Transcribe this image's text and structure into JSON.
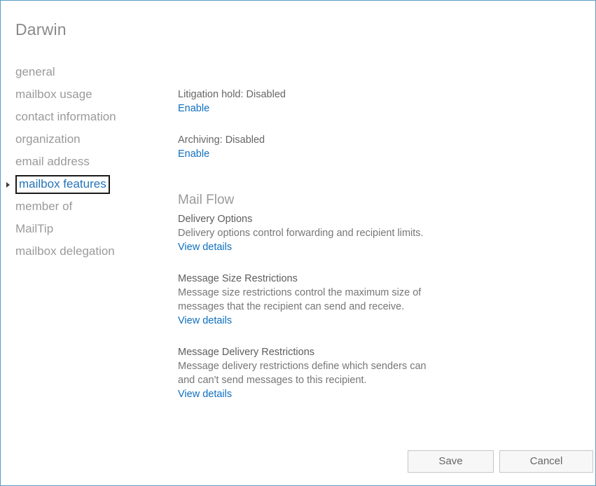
{
  "dialog": {
    "title": "Darwin"
  },
  "nav": {
    "items": [
      {
        "label": "general",
        "selected": false
      },
      {
        "label": "mailbox usage",
        "selected": false
      },
      {
        "label": "contact information",
        "selected": false
      },
      {
        "label": "organization",
        "selected": false
      },
      {
        "label": "email address",
        "selected": false
      },
      {
        "label": "mailbox features",
        "selected": true
      },
      {
        "label": "member of",
        "selected": false
      },
      {
        "label": "MailTip",
        "selected": false
      },
      {
        "label": "mailbox delegation",
        "selected": false
      }
    ]
  },
  "content": {
    "litigation_hold": {
      "status": "Litigation hold: Disabled",
      "action": "Enable"
    },
    "archiving": {
      "status": "Archiving: Disabled",
      "action": "Enable"
    },
    "mail_flow": {
      "heading": "Mail Flow",
      "groups": [
        {
          "title": "Delivery Options",
          "description": "Delivery options control forwarding and recipient limits.",
          "action": "View details"
        },
        {
          "title": "Message Size Restrictions",
          "description": "Message size restrictions control the maximum size of messages that the recipient can send and receive.",
          "action": "View details"
        },
        {
          "title": "Message Delivery Restrictions",
          "description": "Message delivery restrictions define which senders can and can't send messages to this recipient.",
          "action": "View details"
        }
      ]
    }
  },
  "footer": {
    "save_label": "Save",
    "cancel_label": "Cancel"
  },
  "colors": {
    "link": "#0f70bf",
    "selected_nav": "#2573b8",
    "window_border": "#5b9bc4",
    "muted_text": "#9a9a9a"
  }
}
